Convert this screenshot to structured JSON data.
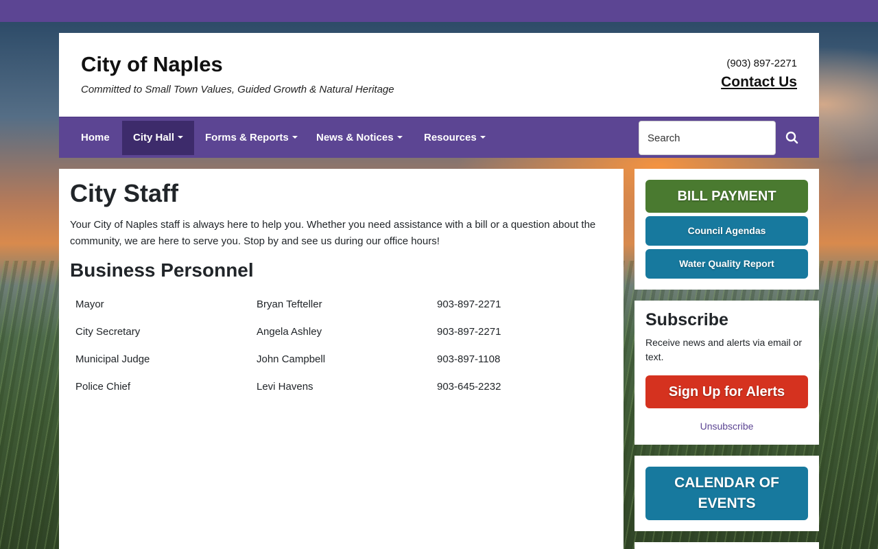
{
  "site": {
    "title": "City of Naples",
    "tagline": "Committed to Small Town Values, Guided Growth & Natural Heritage",
    "phone": "(903) 897-2271",
    "contact_label": "Contact Us"
  },
  "nav": {
    "items": [
      {
        "label": "Home",
        "dropdown": false
      },
      {
        "label": "City Hall",
        "dropdown": true,
        "active": true
      },
      {
        "label": "Forms & Reports",
        "dropdown": true
      },
      {
        "label": "News & Notices",
        "dropdown": true
      },
      {
        "label": "Resources",
        "dropdown": true
      }
    ],
    "search_placeholder": "Search",
    "search_icon": "search-icon"
  },
  "main": {
    "title": "City Staff",
    "intro": "Your City of Naples staff is always here to help you. Whether you need assistance with a bill or a question about the community, we are here to serve you. Stop by and see us during our office hours!",
    "section_title": "Business Personnel",
    "personnel": [
      {
        "role": "Mayor",
        "name": "Bryan Tefteller",
        "phone": "903-897-2271"
      },
      {
        "role": "City Secretary",
        "name": "Angela Ashley",
        "phone": "903-897-2271"
      },
      {
        "role": "Municipal Judge",
        "name": "John Campbell",
        "phone": "903-897-1108"
      },
      {
        "role": "Police Chief",
        "name": "Levi Havens",
        "phone": "903-645-2232"
      }
    ]
  },
  "sidebar": {
    "bill_payment": "BILL PAYMENT",
    "council_agendas": "Council Agendas",
    "water_quality": "Water Quality Report",
    "subscribe_title": "Subscribe",
    "subscribe_text": "Receive news and alerts via email or text.",
    "signup_label": "Sign Up for Alerts",
    "unsubscribe_label": "Unsubscribe",
    "calendar_line1": "CALENDAR OF",
    "calendar_line2": "EVENTS"
  },
  "colors": {
    "brand_purple": "#5c4593",
    "active_purple": "#3d2b6b",
    "bill_green": "#4a7a30",
    "teal": "#17799e",
    "alert_red": "#d5321f"
  }
}
